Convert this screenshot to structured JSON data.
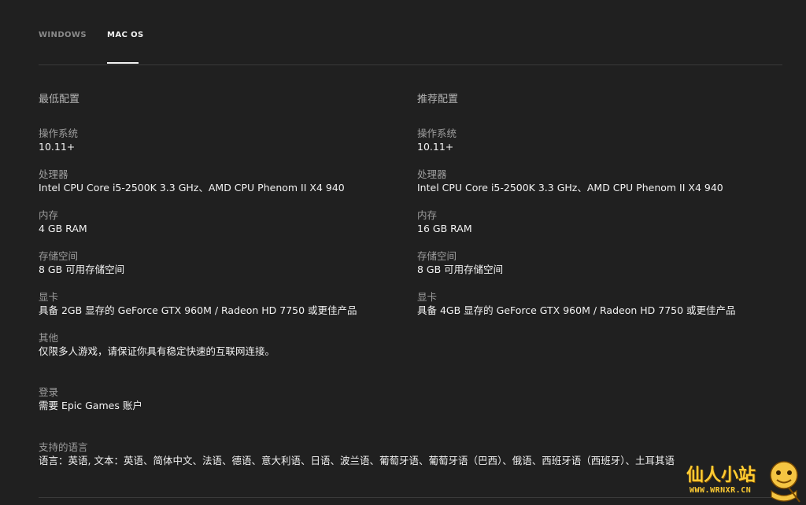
{
  "tabs": [
    {
      "label": "WINDOWS",
      "active": false
    },
    {
      "label": "MAC OS",
      "active": true
    }
  ],
  "minimum": {
    "heading": "最低配置",
    "specs": [
      {
        "label": "操作系统",
        "value": "10.11+"
      },
      {
        "label": "处理器",
        "value": "Intel CPU Core i5-2500K 3.3 GHz、AMD CPU Phenom II X4 940"
      },
      {
        "label": "内存",
        "value": "4 GB RAM"
      },
      {
        "label": "存储空间",
        "value": "8 GB 可用存储空间"
      },
      {
        "label": "显卡",
        "value": "具备 2GB 显存的 GeForce GTX 960M / Radeon HD 7750 或更佳产品"
      },
      {
        "label": "其他",
        "value": "仅限多人游戏，请保证你具有稳定快速的互联网连接。"
      }
    ]
  },
  "recommended": {
    "heading": "推荐配置",
    "specs": [
      {
        "label": "操作系统",
        "value": "10.11+"
      },
      {
        "label": "处理器",
        "value": "Intel CPU Core i5-2500K 3.3 GHz、AMD CPU Phenom II X4 940"
      },
      {
        "label": "内存",
        "value": "16 GB RAM"
      },
      {
        "label": "存储空间",
        "value": "8 GB 可用存储空间"
      },
      {
        "label": "显卡",
        "value": "具备 4GB 显存的 GeForce GTX 960M / Radeon HD 7750 或更佳产品"
      }
    ]
  },
  "login": {
    "label": "登录",
    "value": "需要 Epic Games 账户"
  },
  "languages": {
    "label": "支持的语言",
    "value": "语言：英语, 文本：英语、简体中文、法语、德语、意大利语、日语、波兰语、葡萄牙语、葡萄牙语（巴西）、俄语、西班牙语（西班牙）、土耳其语"
  },
  "watermark": {
    "title": "仙人小站",
    "url": "WWW.WRNXR.CN"
  },
  "colors": {
    "background": "#202020",
    "active_tab": "#f2f2f2",
    "inactive_tab": "#8a8a8a",
    "label": "#9e9e9e",
    "watermark": "#ffcc33"
  }
}
